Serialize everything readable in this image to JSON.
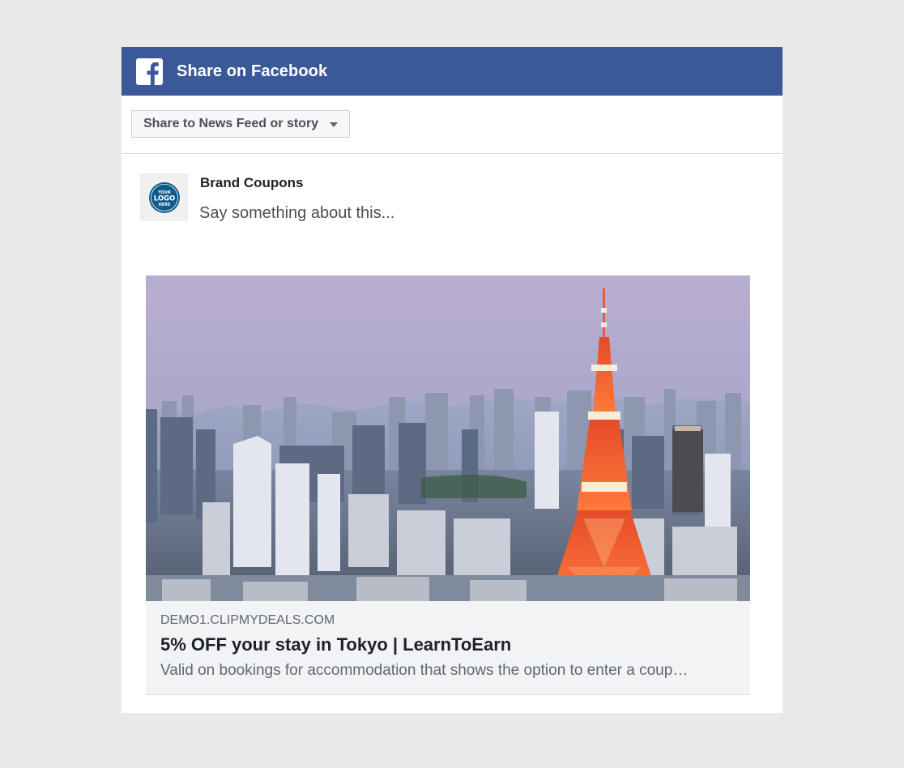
{
  "header": {
    "title": "Share on Facebook",
    "icon": "facebook-icon",
    "color": "#3b5998"
  },
  "toolbar": {
    "share_target": "Share to News Feed or story",
    "caret_icon": "caret-down-icon"
  },
  "composer": {
    "page_name": "Brand Coupons",
    "avatar_logo_text": "YOUR LOGO HERE",
    "placeholder": "Say something about this..."
  },
  "link_preview": {
    "image": "tokyo-skyline-photo",
    "domain": "DEMO1.CLIPMYDEALS.COM",
    "title": "5% OFF your stay in Tokyo | LearnToEarn",
    "description": "Valid on bookings for accommodation that shows the option to enter a coup…"
  }
}
